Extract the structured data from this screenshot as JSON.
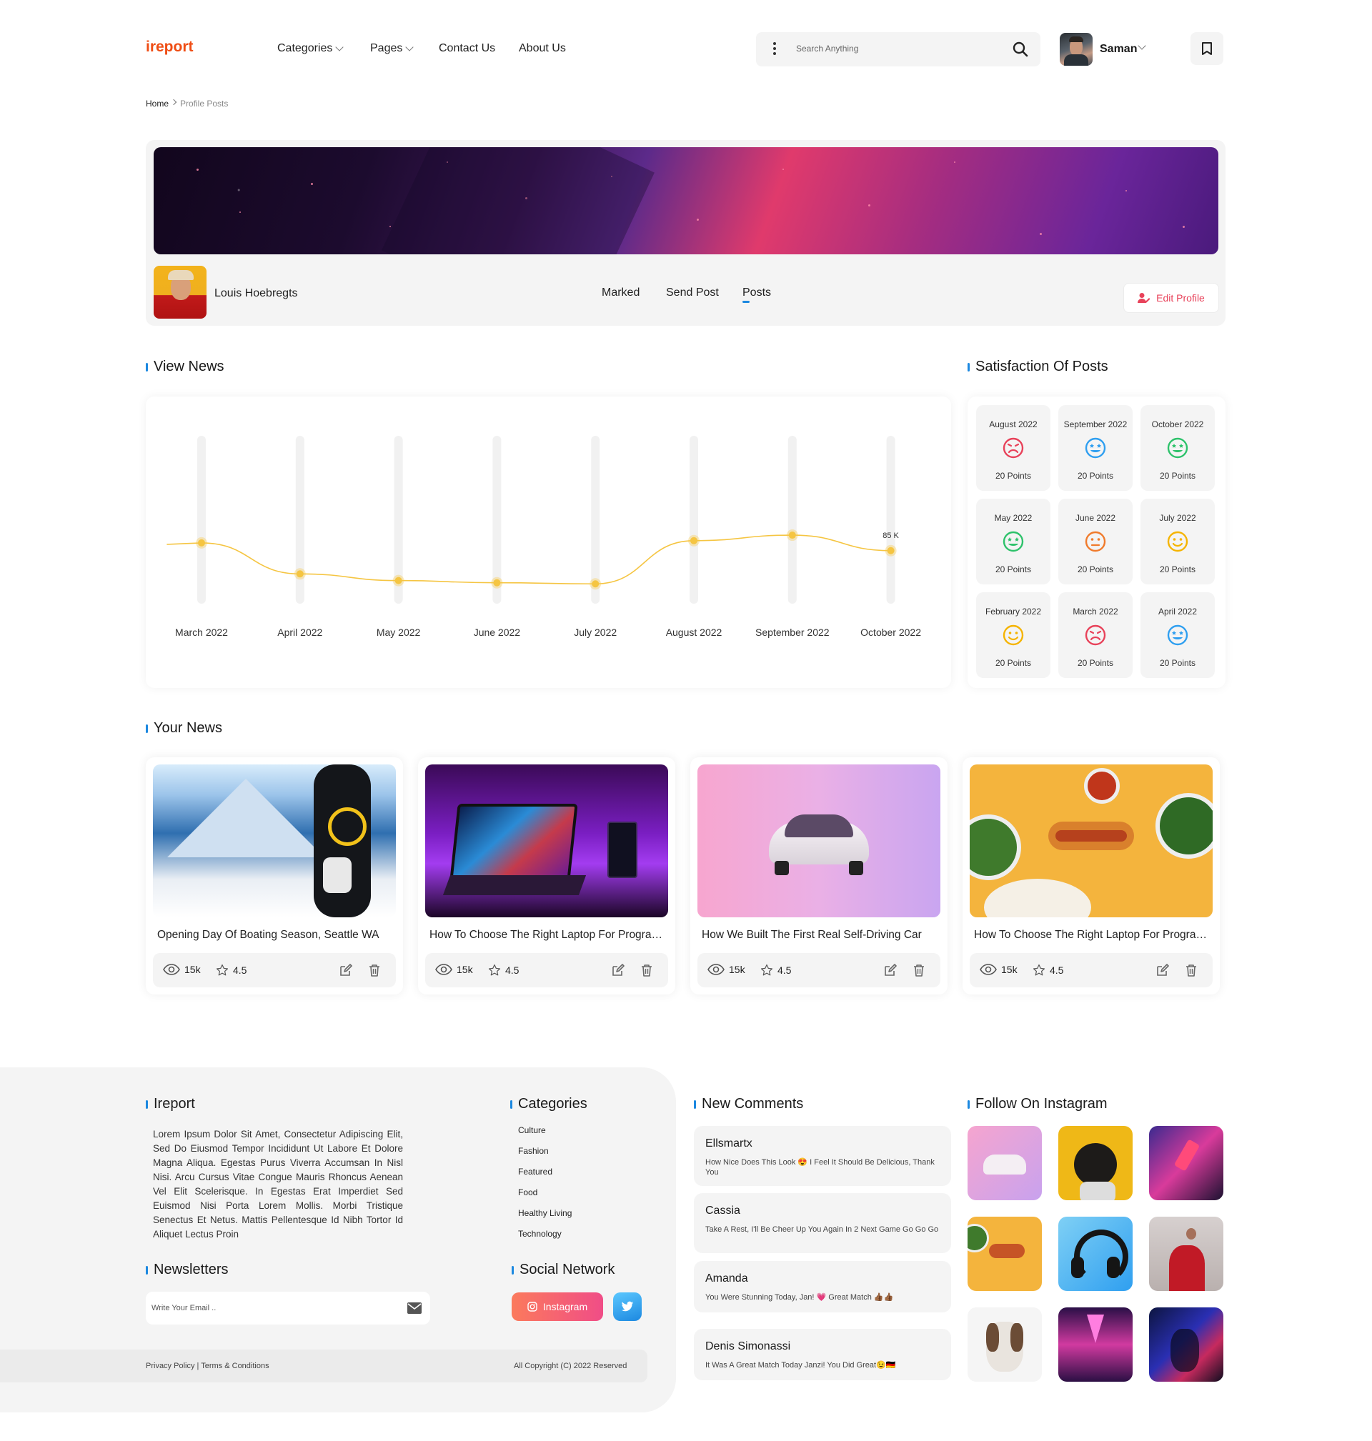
{
  "header": {
    "logo": "ireport",
    "nav": [
      {
        "label": "Categories",
        "has_dropdown": true
      },
      {
        "label": "Pages",
        "has_dropdown": true
      },
      {
        "label": "Contact Us",
        "has_dropdown": false
      },
      {
        "label": "About Us",
        "has_dropdown": false
      }
    ],
    "search_placeholder": "Search Anything",
    "user_name": "Saman"
  },
  "breadcrumb": {
    "home": "Home",
    "current": "Profile Posts"
  },
  "profile": {
    "name": "Louis Hoebregts",
    "tabs": [
      "Marked",
      "Send Post",
      "Posts"
    ],
    "active_tab": "Posts",
    "edit_label": "Edit Profile"
  },
  "view_news": {
    "title": "View News",
    "chart_data": {
      "type": "line",
      "categories": [
        "March 2022",
        "April 2022",
        "May 2022",
        "June 2022",
        "July 2022",
        "August 2022",
        "September 2022",
        "October 2022"
      ],
      "values": [
        92,
        64,
        58,
        56,
        55,
        94,
        99,
        85
      ],
      "annotation": "85 K",
      "color": "#f5c542"
    }
  },
  "satisfaction": {
    "title": "Satisfaction Of Posts",
    "items": [
      {
        "month": "August 2022",
        "points": "20 Points",
        "mood": "angry",
        "color": "#e8425a"
      },
      {
        "month": "September 2022",
        "points": "20 Points",
        "mood": "star-eyes",
        "color": "#2f9ff0"
      },
      {
        "month": "October 2022",
        "points": "20 Points",
        "mood": "star-eyes",
        "color": "#2ec26b"
      },
      {
        "month": "May 2022",
        "points": "20 Points",
        "mood": "star-eyes",
        "color": "#2ec26b"
      },
      {
        "month": "June 2022",
        "points": "20 Points",
        "mood": "neutral",
        "color": "#f07b2c"
      },
      {
        "month": "July 2022",
        "points": "20 Points",
        "mood": "smile",
        "color": "#f5b400"
      },
      {
        "month": "February 2022",
        "points": "20 Points",
        "mood": "smile",
        "color": "#f5b400"
      },
      {
        "month": "March 2022",
        "points": "20 Points",
        "mood": "angry",
        "color": "#e8425a"
      },
      {
        "month": "April 2022",
        "points": "20 Points",
        "mood": "star-eyes",
        "color": "#2f9ff0"
      }
    ]
  },
  "your_news": {
    "title": "Your News",
    "items": [
      {
        "title": "Opening Day Of Boating Season, Seattle WA",
        "views": "15k",
        "rating": "4.5",
        "image": "snowboard-mountain"
      },
      {
        "title": "How To Choose The Right Laptop For Programming",
        "views": "15k",
        "rating": "4.5",
        "image": "purple-laptop"
      },
      {
        "title": "How We Built The First Real Self-Driving Car",
        "views": "15k",
        "rating": "4.5",
        "image": "white-car-pink"
      },
      {
        "title": "How To Choose The Right Laptop For Programming",
        "views": "15k",
        "rating": "4.5",
        "image": "hotdogs-food"
      }
    ]
  },
  "footer": {
    "about_title": "Ireport",
    "about_text": "Lorem Ipsum Dolor Sit Amet, Consectetur Adipiscing Elit, Sed Do Eiusmod Tempor Incididunt Ut Labore Et Dolore Magna Aliqua. Egestas Purus Viverra Accumsan In Nisl Nisi. Arcu Cursus Vitae Congue Mauris Rhoncus Aenean Vel Elit Scelerisque. In Egestas Erat Imperdiet Sed Euismod Nisi Porta Lorem Mollis. Morbi Tristique Senectus Et Netus. Mattis Pellentesque Id Nibh Tortor Id Aliquet Lectus Proin",
    "categories_title": "Categories",
    "categories": [
      "Culture",
      "Fashion",
      "Featured",
      "Food",
      "Healthy Living",
      "Technology"
    ],
    "newsletter_title": "Newsletters",
    "newsletter_placeholder": "Write Your Email ..",
    "social_title": "Social Network",
    "instagram_label": "Instagram",
    "comments_title": "New Comments",
    "comments": [
      {
        "name": "Ellsmartx",
        "text": "How Nice Does This Look 😍 I Feel It Should Be Delicious, Thank You"
      },
      {
        "name": "Cassia",
        "text": "Take A Rest, I'll Be Cheer Up You Again In 2 Next Game Go Go Go"
      },
      {
        "name": "Amanda",
        "text": "You Were Stunning Today, Jan! 💗 Great Match 👍🏾👍🏾"
      },
      {
        "name": "Denis Simonassi",
        "text": "It Was A Great Match Today Janzi! You Did Great😉🇩🇪"
      }
    ],
    "instagram_title": "Follow On Instagram",
    "instagram_photos": [
      "pink-car",
      "pug-yellow",
      "neon-phone",
      "hotdogs",
      "headphones-blue",
      "couple-red-dress",
      "dog-white",
      "neon-tunnel",
      "neon-party"
    ],
    "privacy_text": "Privacy Policy | Terms & Conditions",
    "copyright_text": "All Copyright (C) 2022 Reserved"
  }
}
